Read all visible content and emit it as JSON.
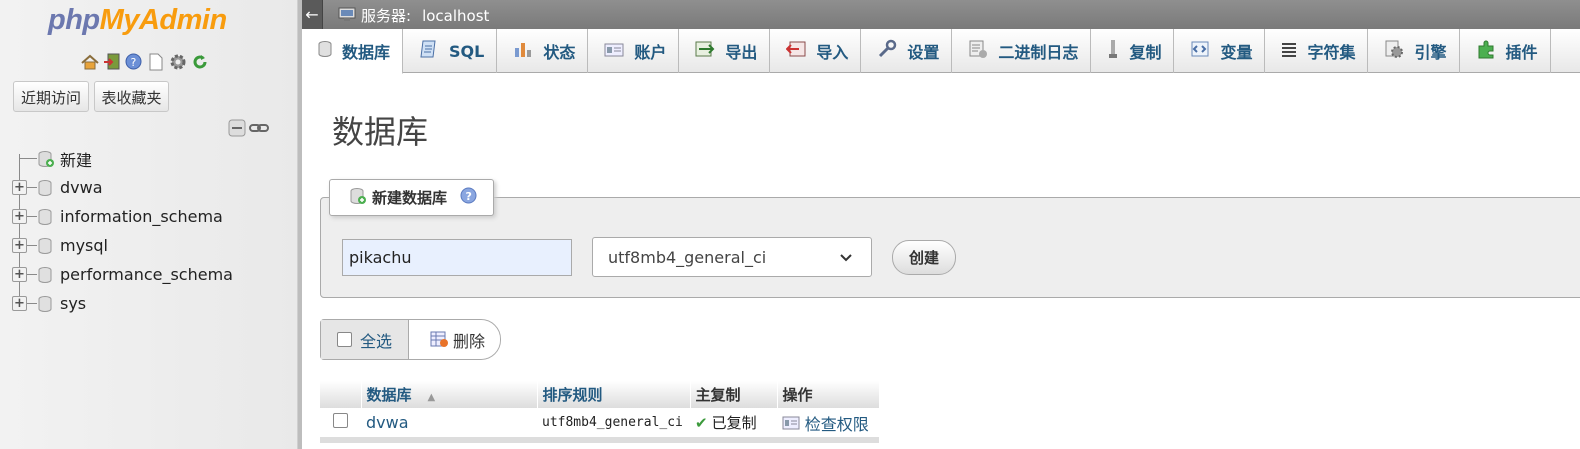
{
  "sidebar": {
    "logo_php": "php",
    "logo_myadmin": "MyAdmin",
    "quick_icons": [
      "home-icon",
      "exit-icon",
      "help-icon",
      "docs-icon",
      "settings-icon",
      "reload-icon"
    ],
    "recent_label": "近期访问",
    "favorites_label": "表收藏夹",
    "tree": {
      "new_label": "新建",
      "databases": [
        "dvwa",
        "information_schema",
        "mysql",
        "performance_schema",
        "sys"
      ]
    }
  },
  "topbar": {
    "back_arrow": "←",
    "server_label": "服务器:",
    "server_name": "localhost"
  },
  "tabs": [
    {
      "label": "数据库",
      "icon": "database-icon",
      "active": true
    },
    {
      "label": "SQL",
      "icon": "sql-icon"
    },
    {
      "label": "状态",
      "icon": "status-icon"
    },
    {
      "label": "账户",
      "icon": "accounts-icon"
    },
    {
      "label": "导出",
      "icon": "export-icon"
    },
    {
      "label": "导入",
      "icon": "import-icon"
    },
    {
      "label": "设置",
      "icon": "settings-icon"
    },
    {
      "label": "二进制日志",
      "icon": "binlog-icon"
    },
    {
      "label": "复制",
      "icon": "replication-icon"
    },
    {
      "label": "变量",
      "icon": "variables-icon"
    },
    {
      "label": "字符集",
      "icon": "charset-icon"
    },
    {
      "label": "引擎",
      "icon": "engine-icon"
    },
    {
      "label": "插件",
      "icon": "plugin-icon"
    }
  ],
  "page": {
    "title": "数据库",
    "create": {
      "legend": "新建数据库",
      "dbname_value": "pikachu",
      "collation": "utf8mb4_general_ci",
      "button": "创建"
    },
    "actions": {
      "select_all": "全选",
      "delete": "删除"
    },
    "table": {
      "headers": [
        "数据库",
        "排序规则",
        "主复制",
        "操作"
      ],
      "rows": [
        {
          "name": "dvwa",
          "collation": "utf8mb4_general_ci",
          "replication": "已复制",
          "action": "检查权限"
        }
      ]
    }
  },
  "colors": {
    "link": "#235a81",
    "logo_php": "#6c78af",
    "logo_myadmin": "#f89c0e"
  }
}
